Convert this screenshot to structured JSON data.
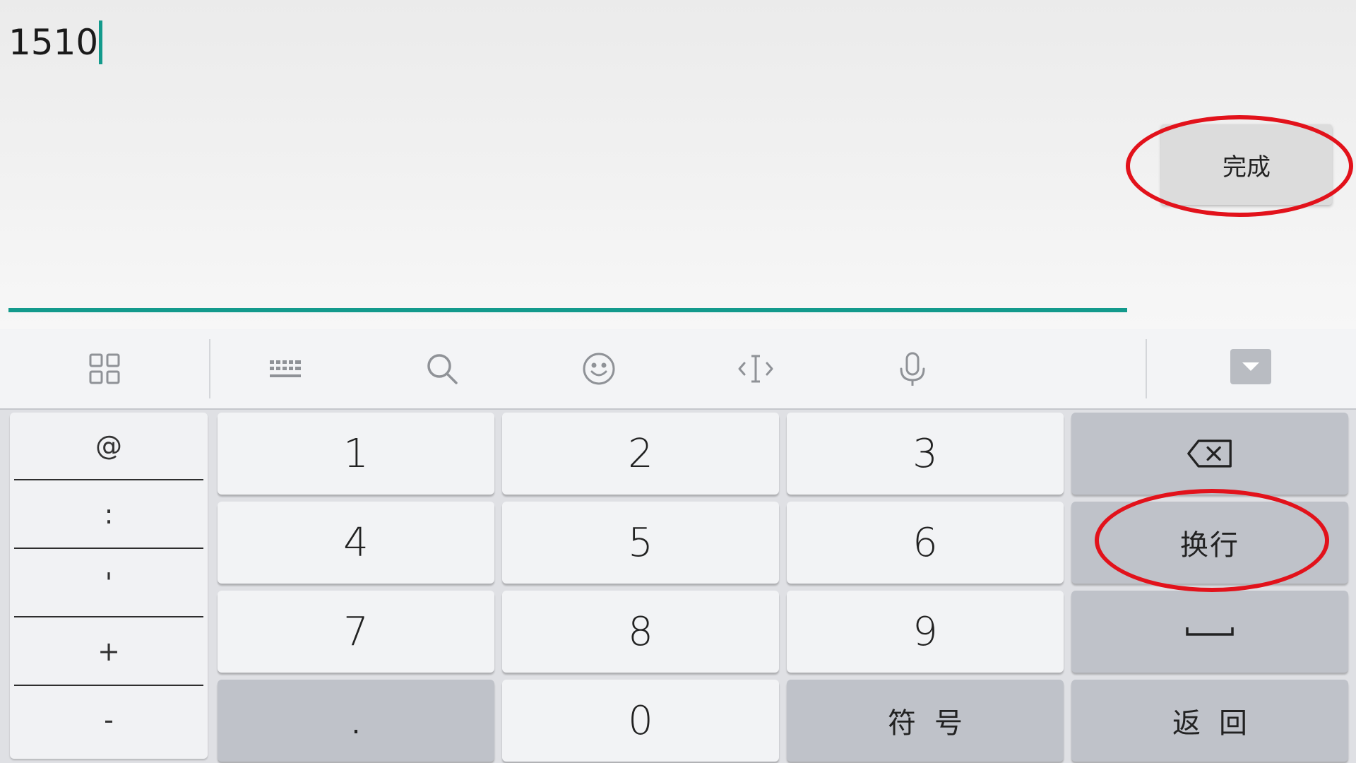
{
  "input": {
    "value": "1510",
    "done_label": "完成"
  },
  "toolbar": {
    "icons": [
      "apps-grid-icon",
      "keyboard-icon",
      "search-icon",
      "emoji-icon",
      "cursor-edit-icon",
      "microphone-icon",
      "collapse-keyboard-icon"
    ]
  },
  "symbols": [
    "@",
    ":",
    "'",
    "+",
    "-"
  ],
  "keys": {
    "row1": [
      "1",
      "2",
      "3"
    ],
    "row2": [
      "4",
      "5",
      "6"
    ],
    "row3": [
      "7",
      "8",
      "9"
    ],
    "dot": ".",
    "zero": "0",
    "symbol_key": "符号",
    "newline": "换行",
    "back": "返回"
  },
  "colors": {
    "accent": "#139a8c",
    "highlight": "#e2121b",
    "key_light": "#f2f3f5",
    "key_dark": "#bfc2c9"
  }
}
